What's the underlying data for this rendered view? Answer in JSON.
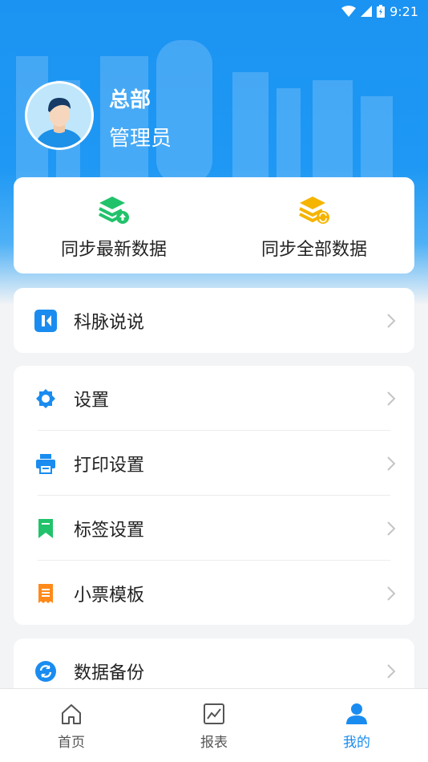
{
  "status_bar": {
    "time": "9:21"
  },
  "profile": {
    "org_name": "总部",
    "role": "管理员"
  },
  "sync": {
    "latest_label": "同步最新数据",
    "all_label": "同步全部数据"
  },
  "menu": {
    "kemai_label": "科脉说说",
    "settings_label": "设置",
    "print_label": "打印设置",
    "tag_label": "标签设置",
    "receipt_label": "小票模板",
    "backup_label": "数据备份"
  },
  "tabs": {
    "home_label": "首页",
    "report_label": "报表",
    "mine_label": "我的"
  },
  "colors": {
    "brand_blue": "#1a8cf0",
    "green": "#22c26b",
    "orange": "#ff8a1a",
    "gold": "#f5b400"
  }
}
